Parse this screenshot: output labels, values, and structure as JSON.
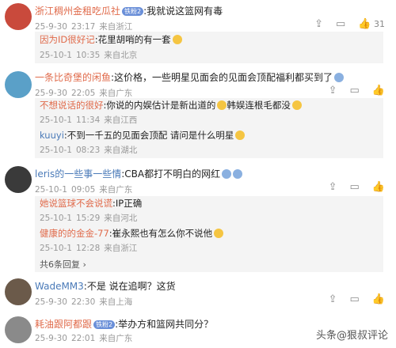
{
  "posts": [
    {
      "user": "浙江稠州金租吃瓜社",
      "badge": "铁粉2",
      "text": ":我就说这篮网有毒",
      "date": "25-9-30",
      "time": "23:17",
      "location": "来自浙江",
      "likes": "31",
      "avatar_color": "#c94a3c",
      "replies": [
        {
          "user": "因为ID很好记",
          "text": ":花里胡哨的有一套",
          "date": "25-10-1",
          "time": "10:35",
          "location": "来自北京"
        }
      ]
    },
    {
      "user": "一条比奇堡的闲鱼",
      "text": ":这价格，一些明星见面会的见面会顶配福利都买到了",
      "date": "25-9-30",
      "time": "22:05",
      "location": "来自广东",
      "likes": "",
      "avatar_color": "#5aa0c8",
      "replies": [
        {
          "user": "不想说话的很好",
          "text": ":你说的内娱估计是新出道的",
          "text2": "韩娱连根毛都没",
          "date": "25-10-1",
          "time": "11:34",
          "location": "来自江西"
        },
        {
          "user": "kuuyi",
          "text": ":不到一千五的见面会顶配 请问是什么明星",
          "date": "25-10-1",
          "time": "08:23",
          "location": "来自湖北"
        }
      ]
    },
    {
      "user": "leris的一些事一些情",
      "text": ":CBA都打不明白的网红",
      "date": "25-10-1",
      "time": "09:05",
      "location": "来自广东",
      "likes": "",
      "avatar_color": "#3a3a3a",
      "replies": [
        {
          "user": "她说篮球不会说谎",
          "text": ":IP正确",
          "date": "25-10-1",
          "time": "15:29",
          "location": "来自河北"
        },
        {
          "user": "健康的的金金-77",
          "text": ":崔永熙也有怎么你不说他",
          "date": "25-10-1",
          "time": "12:28",
          "location": "来自浙江"
        }
      ],
      "more": "共6条回复"
    },
    {
      "user": "WadeMM3",
      "text": ":不是 说在追啊？这货",
      "date": "25-9-30",
      "time": "22:30",
      "location": "来自上海",
      "likes": "",
      "avatar_color": "#6b5a4a",
      "replies": []
    },
    {
      "user": "耗油跟阿都跟",
      "badge": "铁粉2",
      "text": ":举办方和篮网共同分？",
      "date": "25-9-30",
      "time": "22:01",
      "location": "来自广东",
      "likes": "",
      "avatar_color": "#8a8a8a",
      "replies": []
    }
  ],
  "watermark": "头条@狠叔评论",
  "icons": {
    "share": "share-icon",
    "comment": "comment-icon",
    "like": "like-icon"
  }
}
